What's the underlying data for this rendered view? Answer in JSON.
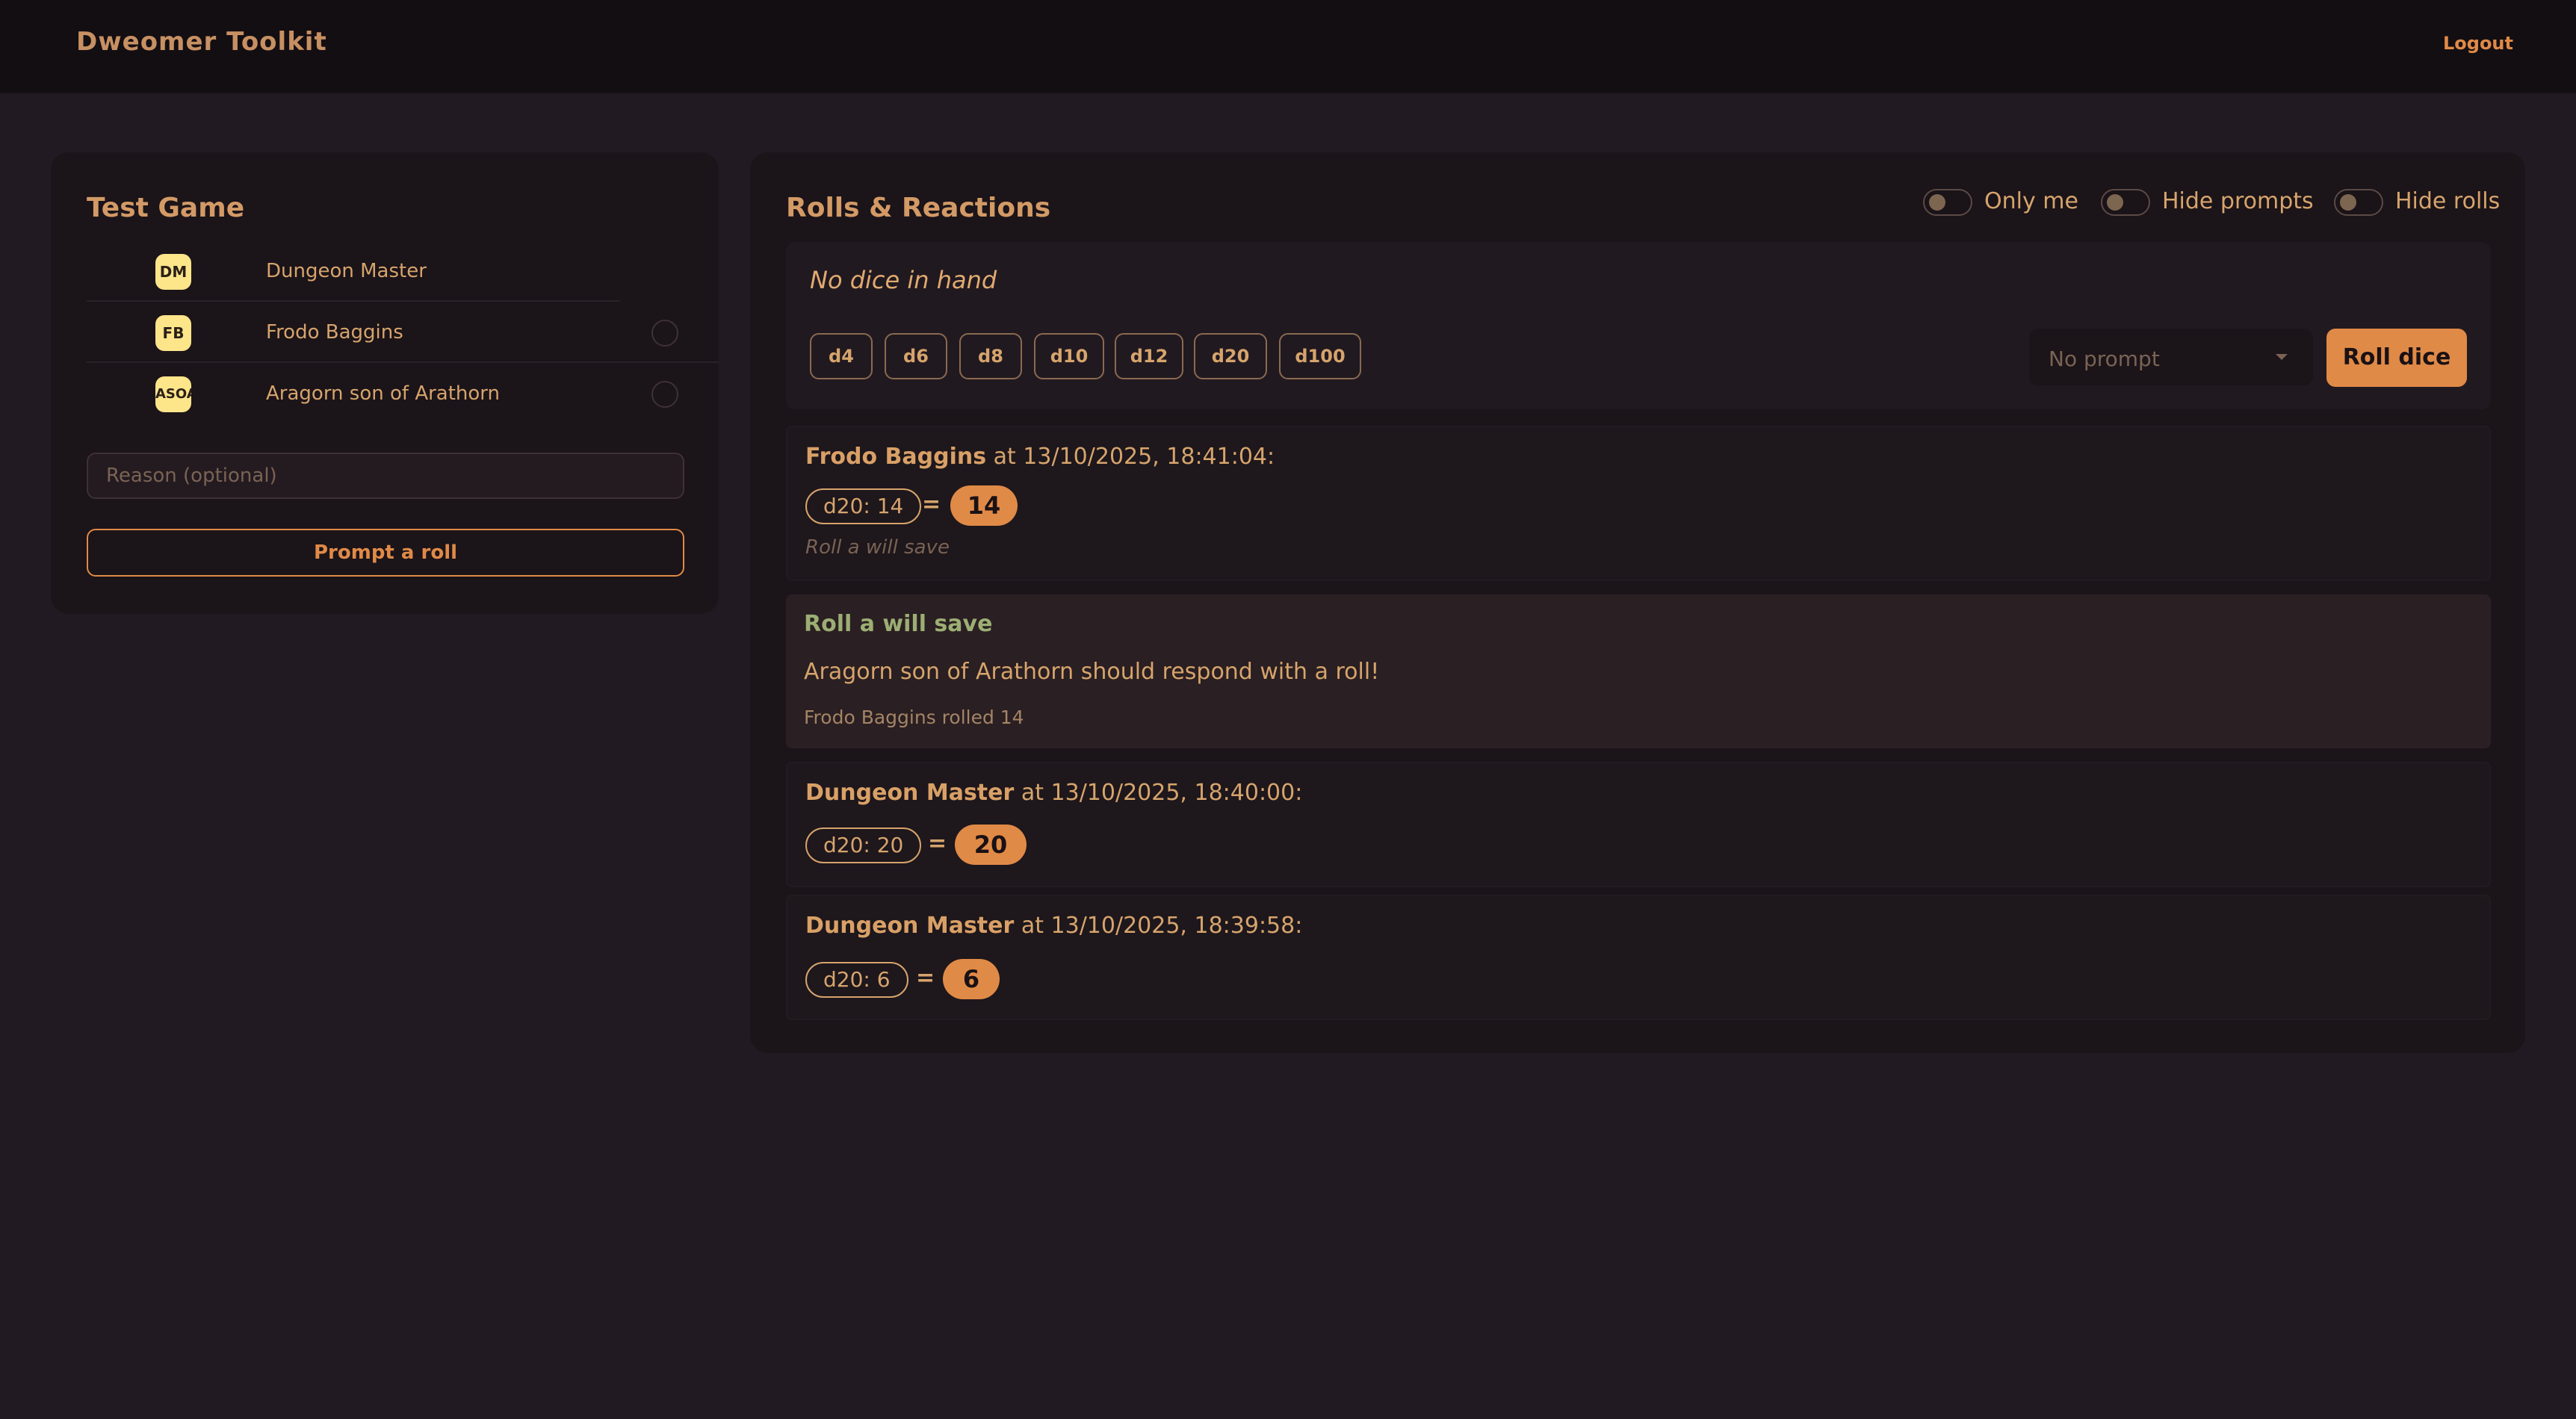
{
  "app": {
    "brand": "Dweomer Toolkit",
    "logout_label": "Logout"
  },
  "game": {
    "title": "Test Game",
    "players": [
      {
        "initials": "DM",
        "name": "Dungeon Master"
      },
      {
        "initials": "FB",
        "name": "Frodo Baggins"
      },
      {
        "initials": "ASOA",
        "name": "Aragorn son of Arathorn"
      }
    ],
    "reason_placeholder": "Reason (optional)",
    "prompt_button": "Prompt a roll"
  },
  "rolls": {
    "title": "Rolls & Reactions",
    "toggles": [
      {
        "label": "Only me",
        "on": false
      },
      {
        "label": "Hide prompts",
        "on": false
      },
      {
        "label": "Hide rolls",
        "on": false
      }
    ],
    "hand": {
      "empty_text": "No dice in hand",
      "dice": [
        "d4",
        "d6",
        "d8",
        "d10",
        "d12",
        "d20",
        "d100"
      ],
      "prompt_select": "No prompt",
      "roll_button": "Roll dice"
    },
    "entries": [
      {
        "name": "Frodo Baggins",
        "when": " at 13/10/2025, 18:41:04:",
        "dice": "d20: 14",
        "equals": "=",
        "total": "14",
        "note": "Roll a will save"
      },
      {
        "name": "Dungeon Master",
        "when": " at 13/10/2025, 18:40:00:",
        "dice": "d20: 20",
        "equals": "=",
        "total": "20"
      },
      {
        "name": "Dungeon Master",
        "when": " at 13/10/2025, 18:39:58:",
        "dice": "d20: 6",
        "equals": "=",
        "total": "6"
      }
    ],
    "prompt": {
      "title": "Roll a will save",
      "message": "Aragorn son of Arathorn should respond with a roll!",
      "status": "Frodo Baggins rolled 14"
    }
  },
  "colors": {
    "accent": "#e08a47",
    "background": "#221a22",
    "panel": "#1b1419",
    "prompt_title": "#9cae74",
    "avatar": "#fde58a"
  }
}
